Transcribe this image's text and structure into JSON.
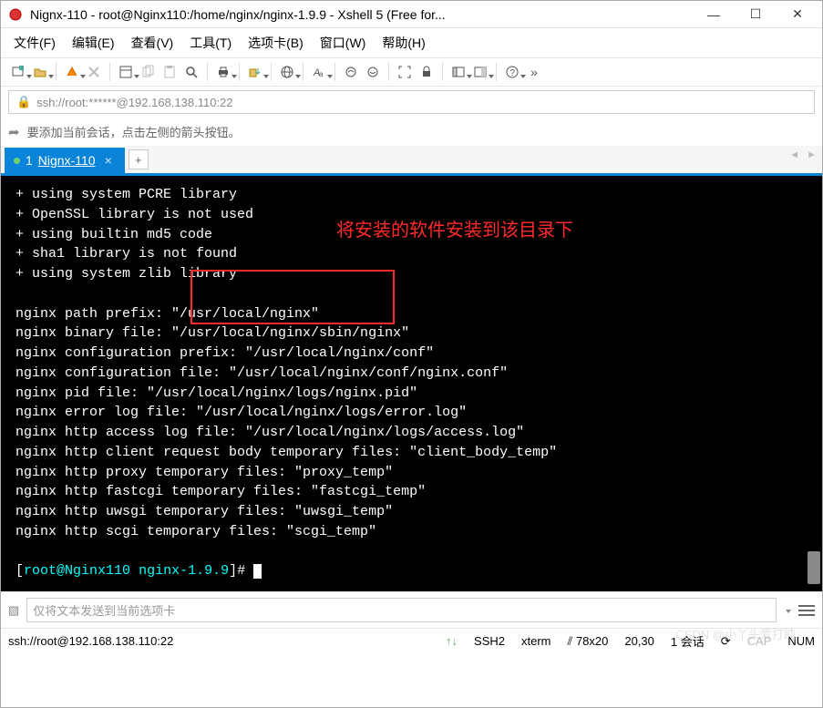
{
  "window": {
    "title": "Nignx-110 - root@Nginx110:/home/nginx/nginx-1.9.9 - Xshell 5 (Free for...",
    "minimize": "—",
    "maximize": "☐",
    "close": "✕"
  },
  "menu": {
    "file": "文件(F)",
    "edit": "编辑(E)",
    "view": "查看(V)",
    "tools": "工具(T)",
    "tab": "选项卡(B)",
    "window": "窗口(W)",
    "help": "帮助(H)"
  },
  "address": {
    "scheme_icon": "🔒",
    "url": "ssh://root:******@192.168.138.110:22"
  },
  "infobar": {
    "hint": "要添加当前会话，点击左侧的箭头按钮。"
  },
  "tabs": {
    "active": {
      "index": "1",
      "label": "Nignx-110"
    },
    "add": "+"
  },
  "terminal": {
    "lines": [
      "+ using system PCRE library",
      "+ OpenSSL library is not used",
      "+ using builtin md5 code",
      "+ sha1 library is not found",
      "+ using system zlib library",
      "",
      "nginx path prefix: \"/usr/local/nginx\"",
      "nginx binary file: \"/usr/local/nginx/sbin/nginx\"",
      "nginx configuration prefix: \"/usr/local/nginx/conf\"",
      "nginx configuration file: \"/usr/local/nginx/conf/nginx.conf\"",
      "nginx pid file: \"/usr/local/nginx/logs/nginx.pid\"",
      "nginx error log file: \"/usr/local/nginx/logs/error.log\"",
      "nginx http access log file: \"/usr/local/nginx/logs/access.log\"",
      "nginx http client request body temporary files: \"client_body_temp\"",
      "nginx http proxy temporary files: \"proxy_temp\"",
      "nginx http fastcgi temporary files: \"fastcgi_temp\"",
      "nginx http uwsgi temporary files: \"uwsgi_temp\"",
      "nginx http scgi temporary files: \"scgi_temp\"",
      ""
    ],
    "prompt_pre": "[",
    "prompt_user": "root@Nginx110",
    "prompt_sep": " ",
    "prompt_dir": "nginx-1.9.9",
    "prompt_post": "]# ",
    "annotation": "将安装的软件安装到该目录下"
  },
  "sendbar": {
    "placeholder": "仅将文本发送到当前选项卡"
  },
  "status": {
    "conn": "ssh://root@192.168.138.110:22",
    "proto": "SSH2",
    "term": "xterm",
    "size": "78x20",
    "cursor": "20,30",
    "session": "1 会话",
    "cap": "CAP",
    "num": "NUM",
    "net_icon": "↑↓"
  },
  "watermark": "CSDN @小丫头爱打盹"
}
